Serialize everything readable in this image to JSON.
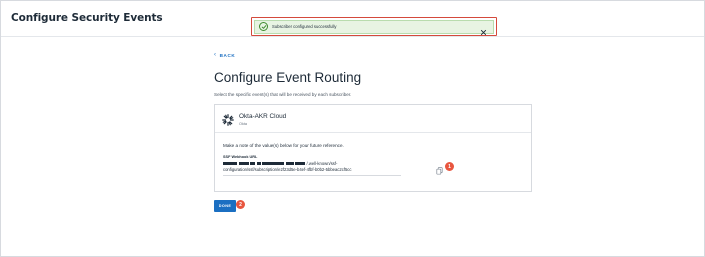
{
  "header": {
    "title": "Configure Security Events"
  },
  "toast": {
    "message": "Subscriber configured successfully",
    "icon": "check-circle-icon",
    "close_icon": "close-icon"
  },
  "nav": {
    "back_label": "BACK"
  },
  "main": {
    "heading": "Configure Event Routing",
    "subtitle": "Select the specific event(s) that will be received by each subscriber."
  },
  "subscriber": {
    "name": "Okta-AKR Cloud",
    "type": "Okta",
    "logo": "okta-logo"
  },
  "details": {
    "note": "Make a note of the value(s) below for your future reference.",
    "field_label": "SSF Webhook URL",
    "url_line1_visible": "/.well-known/ssf-",
    "url_line2": "configuration/ssf/subscription/e2f23d5e-b4ef-4fbf-b0b2-5bbeac2cf5cc",
    "copy_icon": "copy-icon"
  },
  "markers": {
    "one": "1",
    "two": "2"
  },
  "actions": {
    "done_label": "DONE"
  },
  "colors": {
    "accent": "#1b6fc2",
    "toast_bg": "#e8f4e3",
    "toast_outline": "#d44a3c",
    "marker": "#e8563f"
  }
}
